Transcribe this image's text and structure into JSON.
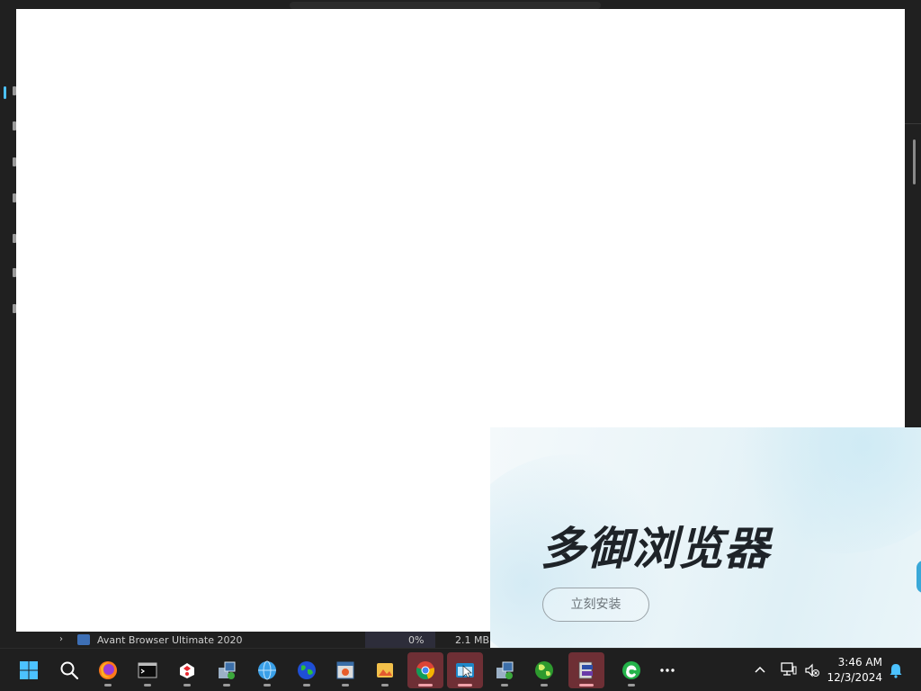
{
  "background_window": {
    "process_row": {
      "name": "Avant Browser Ultimate 2020",
      "cpu": "0%",
      "memory": "2.1 MB"
    }
  },
  "ad_popup": {
    "title": "多御浏览器",
    "install_button": "立刻安装"
  },
  "taskbar": {
    "apps": [
      {
        "icon": "windows-start-icon"
      },
      {
        "icon": "search-icon"
      },
      {
        "icon": "firefox-icon"
      },
      {
        "icon": "terminal-icon"
      },
      {
        "icon": "puffin-icon"
      },
      {
        "icon": "installer-icon"
      },
      {
        "icon": "globe-browser-icon"
      },
      {
        "icon": "earth-icon"
      },
      {
        "icon": "window-app-icon"
      },
      {
        "icon": "photo-app-icon"
      },
      {
        "icon": "chrome-icon"
      },
      {
        "icon": "browser-window-icon"
      },
      {
        "icon": "installer-icon-2"
      },
      {
        "icon": "green-globe-icon"
      },
      {
        "icon": "setup-wizard-icon"
      },
      {
        "icon": "green-e-icon"
      },
      {
        "icon": "more-icon"
      }
    ],
    "tray": {
      "time": "3:46 AM",
      "date": "12/3/2024"
    },
    "colors": {
      "taskbar_bg": "#1f1f1f",
      "active_highlight": "#6e2f35",
      "windows_blue": "#4cc2ff"
    }
  }
}
